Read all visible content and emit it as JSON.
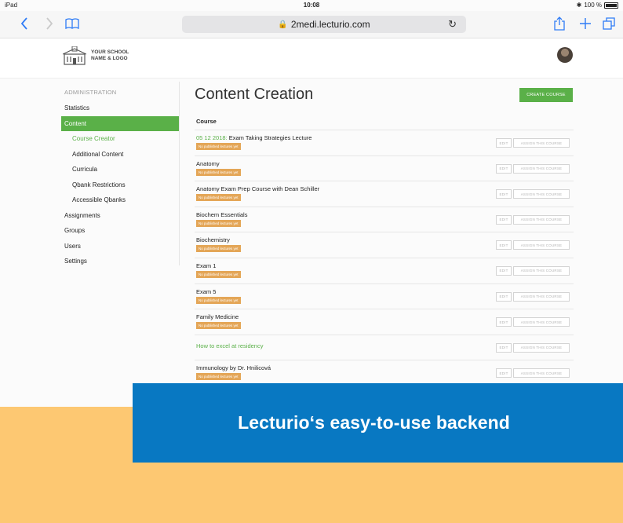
{
  "status_bar": {
    "carrier": "iPad",
    "time": "10:08",
    "battery": "100 %"
  },
  "browser": {
    "url": "2medi.lecturio.com"
  },
  "header": {
    "logo_line1": "YOUR SCHOOL",
    "logo_line2": "NAME & LOGO"
  },
  "sidebar": {
    "heading": "ADMINISTRATION",
    "items": [
      {
        "label": "Statistics"
      },
      {
        "label": "Content"
      },
      {
        "label": "Course Creator"
      },
      {
        "label": "Additional Content"
      },
      {
        "label": "Curricula"
      },
      {
        "label": "Qbank Restrictions"
      },
      {
        "label": "Accessible Qbanks"
      },
      {
        "label": "Assignments"
      },
      {
        "label": "Groups"
      },
      {
        "label": "Users"
      },
      {
        "label": "Settings"
      }
    ]
  },
  "main": {
    "title": "Content Creation",
    "create_button": "CREATE COURSE",
    "column_header": "Course",
    "edit_label": "EDIT",
    "assign_label": "ASSIGN THIS COURSE",
    "rows": [
      {
        "date": "05 12 2018:",
        "title": " Exam Taking Strategies Lecture",
        "badge": "No published lectures yet"
      },
      {
        "title": "Anatomy",
        "badge": "No published lectures yet"
      },
      {
        "title": "Anatomy Exam Prep Course with Dean Schiller",
        "badge": "No published lectures yet"
      },
      {
        "title": "Biochem Essentials",
        "badge": "No published lectures yet"
      },
      {
        "title": "Biochemistry",
        "badge": "No published lectures yet"
      },
      {
        "title": "Exam 1",
        "badge": "No published lectures yet"
      },
      {
        "title": "Exam 5",
        "badge": "No published lectures yet"
      },
      {
        "title": "Family Medicine",
        "badge": "No published lectures yet"
      },
      {
        "title": "How to excel at residency"
      },
      {
        "title": "Immunology by Dr. Hnilicová",
        "badge": "No published lectures yet"
      }
    ]
  },
  "banner": {
    "text": "Lecturio‘s easy-to-use backend"
  },
  "colors": {
    "green": "#5ab048",
    "badge": "#e4a657",
    "banner": "#0878c2",
    "background": "#fdc872"
  }
}
